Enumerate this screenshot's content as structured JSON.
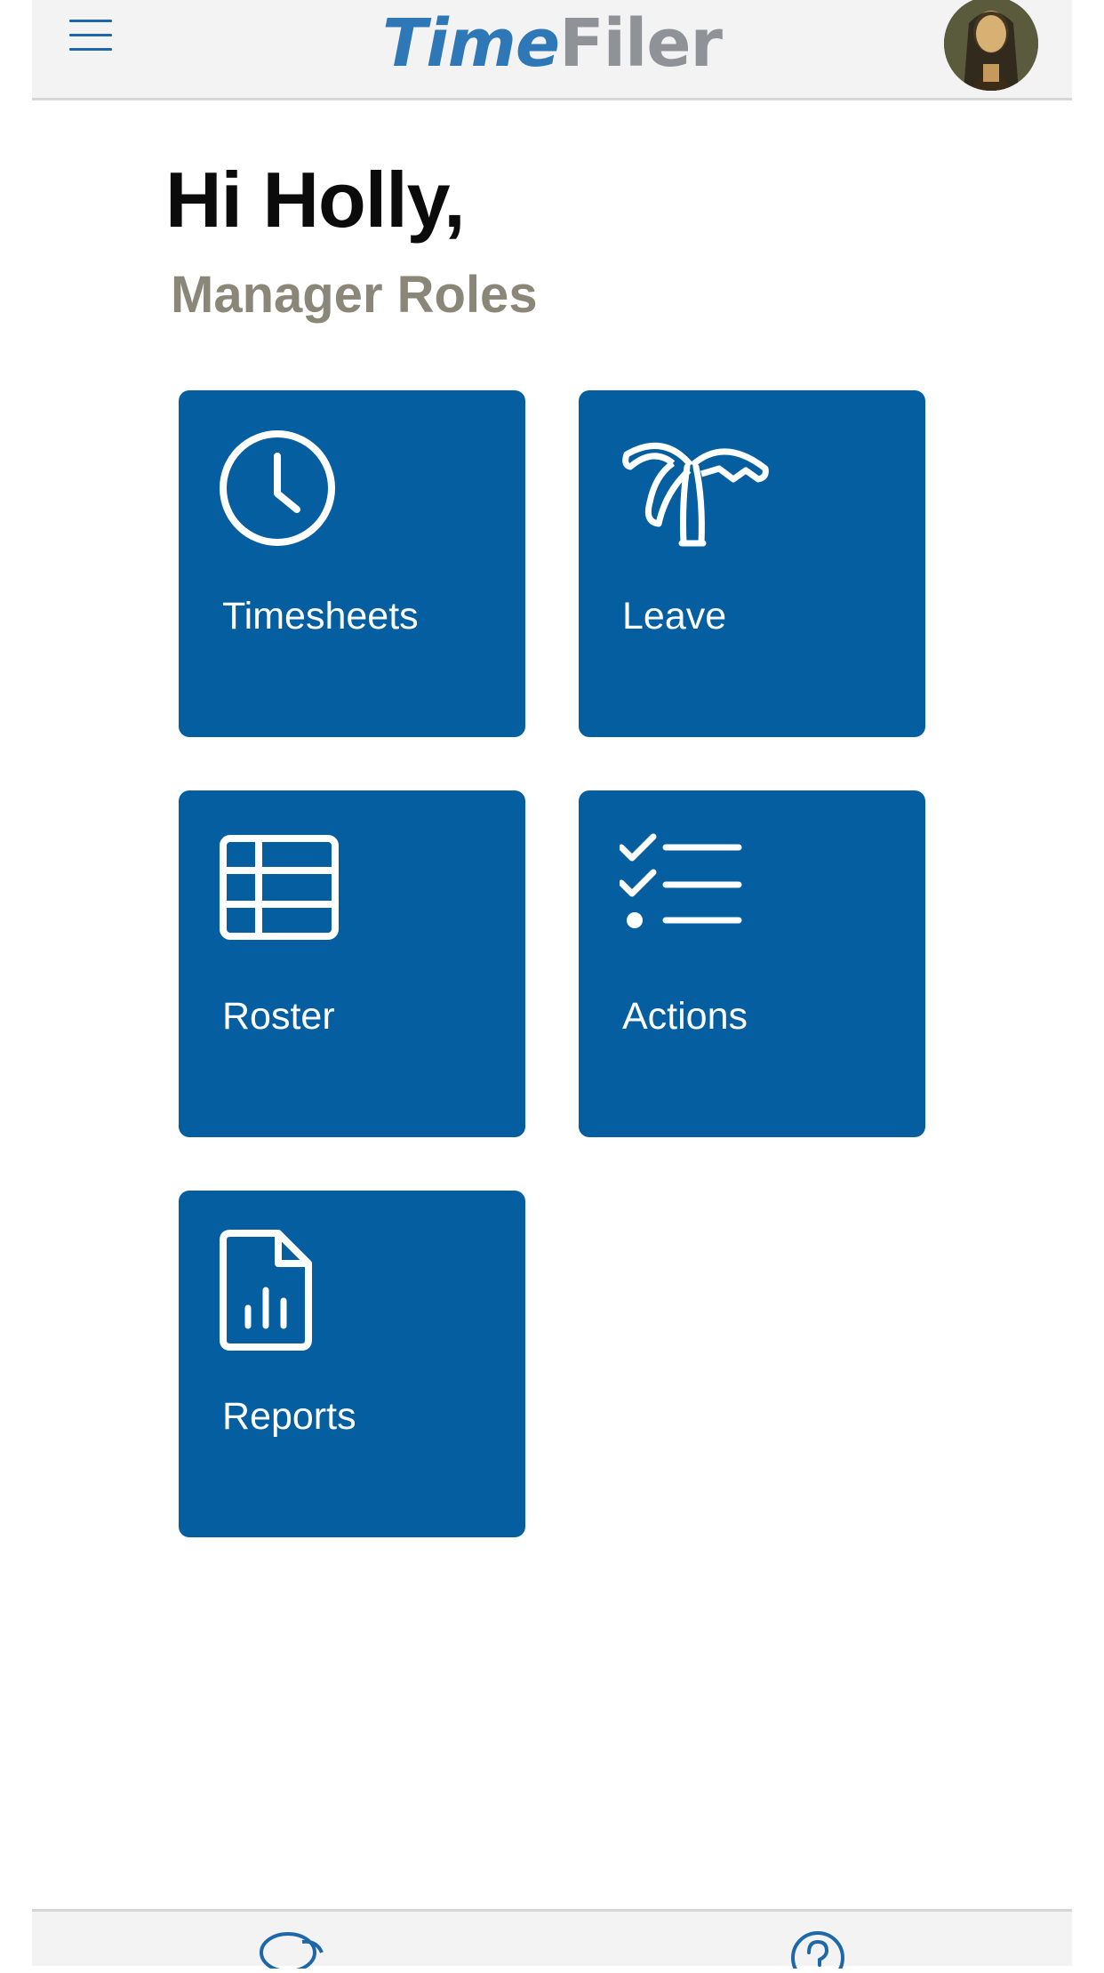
{
  "header": {
    "logo_part1": "Time",
    "logo_part2": "Filer",
    "menu_icon": "hamburger-menu-icon",
    "avatar_icon": "user-avatar"
  },
  "greeting": {
    "title": "Hi Holly,",
    "subtitle": "Manager Roles"
  },
  "tiles": [
    {
      "label": "Timesheets",
      "icon": "clock-icon"
    },
    {
      "label": "Leave",
      "icon": "palm-tree-icon"
    },
    {
      "label": "Roster",
      "icon": "table-grid-icon"
    },
    {
      "label": "Actions",
      "icon": "checklist-icon"
    },
    {
      "label": "Reports",
      "icon": "report-document-icon"
    }
  ],
  "footer": {
    "items": [
      {
        "icon": "chat-bubbles-icon"
      },
      {
        "icon": "help-circle-icon"
      }
    ]
  },
  "colors": {
    "brand_blue": "#045e9f",
    "logo_blue": "#2f78b7",
    "logo_gray": "#8f9398",
    "subtitle_gray": "#8a8678",
    "header_bg": "#f3f3f3"
  }
}
